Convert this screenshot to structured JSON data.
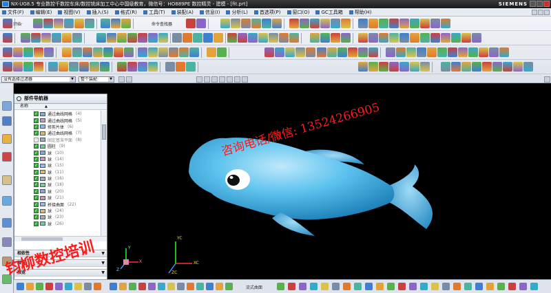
{
  "window": {
    "title": "NX-UG8.5 专业数控千数控车床/数控铣床加工中心中国级教育，微信号：HO889PE 数控精灵 - 建模 - [fit.prt]",
    "brand": "SIEMENS"
  },
  "menu": [
    "文件(F)",
    "编辑(E)",
    "视图(V)",
    "插入(S)",
    "格式(R)",
    "工具(T)",
    "装配(A)",
    "信息(I)",
    "分析(L)",
    "首选项(P)",
    "窗口(O)",
    "GC工具箱",
    "帮助(H)"
  ],
  "toolbar": {
    "start_label": "开始·",
    "command_finder_label": "命令查找器"
  },
  "filter": {
    "type_filter": "没有选择过滤器",
    "assembly_filter": "整个装配"
  },
  "navigator": {
    "title": "部件导航器",
    "column_name": "名称",
    "rows": [
      {
        "name": "通过曲线网格",
        "count": "(4)",
        "on": true
      },
      {
        "name": "通过曲线网格",
        "count": "(5)",
        "on": true
      },
      {
        "name": "修剪片体",
        "count": "(6)",
        "on": true
      },
      {
        "name": "通过曲线网格",
        "count": "(7)",
        "on": true
      },
      {
        "name": "固定基准平面",
        "count": "(8)",
        "on": false
      },
      {
        "name": "圆柱",
        "count": "(9)",
        "on": true
      },
      {
        "name": "球",
        "count": "(10)",
        "on": true
      },
      {
        "name": "球",
        "count": "(14)",
        "on": true
      },
      {
        "name": "球",
        "count": "(15)",
        "on": true
      },
      {
        "name": "球",
        "count": "(11)",
        "on": true
      },
      {
        "name": "球",
        "count": "(16)",
        "on": true
      },
      {
        "name": "球",
        "count": "(18)",
        "on": true
      },
      {
        "name": "球",
        "count": "(20)",
        "on": true
      },
      {
        "name": "球",
        "count": "(21)",
        "on": true
      },
      {
        "name": "桥接曲面",
        "count": "(22)",
        "on": true
      },
      {
        "name": "球",
        "count": "(24)",
        "on": true
      },
      {
        "name": "球",
        "count": "(23)",
        "on": true
      },
      {
        "name": "球",
        "count": "(26)",
        "on": true
      }
    ],
    "sections": [
      "相依性",
      "细节",
      "预览"
    ]
  },
  "viewport": {
    "background": "#000000",
    "model_color": "#4db8e8",
    "csys_labels": {
      "zc": "ZC",
      "yc": "YC",
      "xc": "XC",
      "z": "Z",
      "y": "Y",
      "x": "X"
    }
  },
  "bottom_toolbar": {
    "snap_label": "流式曲面"
  },
  "watermark": {
    "line1": "咨询电话/微信: 13524266905",
    "line2": "钧柳数控培训"
  }
}
